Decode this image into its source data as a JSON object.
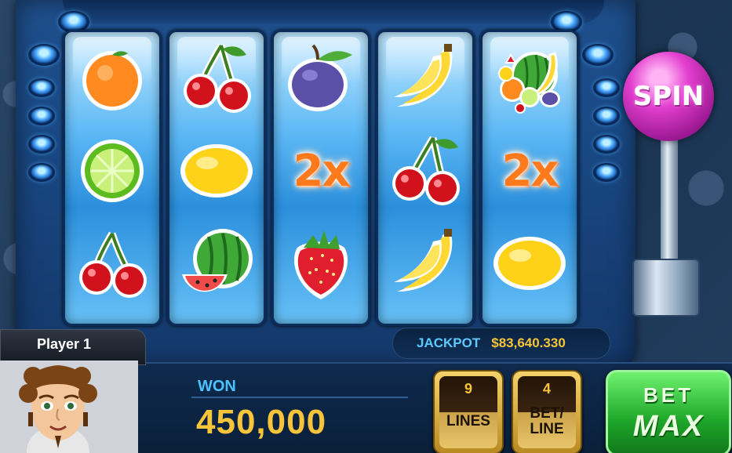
{
  "player": {
    "name": "Player 1"
  },
  "spin": {
    "label": "SPIN"
  },
  "jackpot": {
    "label": "JACKPOT",
    "value": "$83,640.330"
  },
  "won": {
    "label": "WON",
    "value": "450,000"
  },
  "lines": {
    "value": "9",
    "label": "LINES"
  },
  "bet_line": {
    "value": "4",
    "label_1": "BET/",
    "label_2": "LINE"
  },
  "bet_max": {
    "label_1": "BET",
    "label_2": "MAX"
  },
  "reels": [
    [
      "orange",
      "lime",
      "cherry"
    ],
    [
      "cherry",
      "lemon",
      "watermelon"
    ],
    [
      "plum",
      "2x",
      "strawberry"
    ],
    [
      "banana",
      "cherry",
      "banana"
    ],
    [
      "fruit-mix",
      "2x",
      "lemon"
    ]
  ],
  "multiplier_text": "2x",
  "colors": {
    "accent_blue": "#4cc3ff",
    "gold": "#f7c43a",
    "spin_pink": "#e23fcf",
    "bet_green": "#1ea62a"
  }
}
